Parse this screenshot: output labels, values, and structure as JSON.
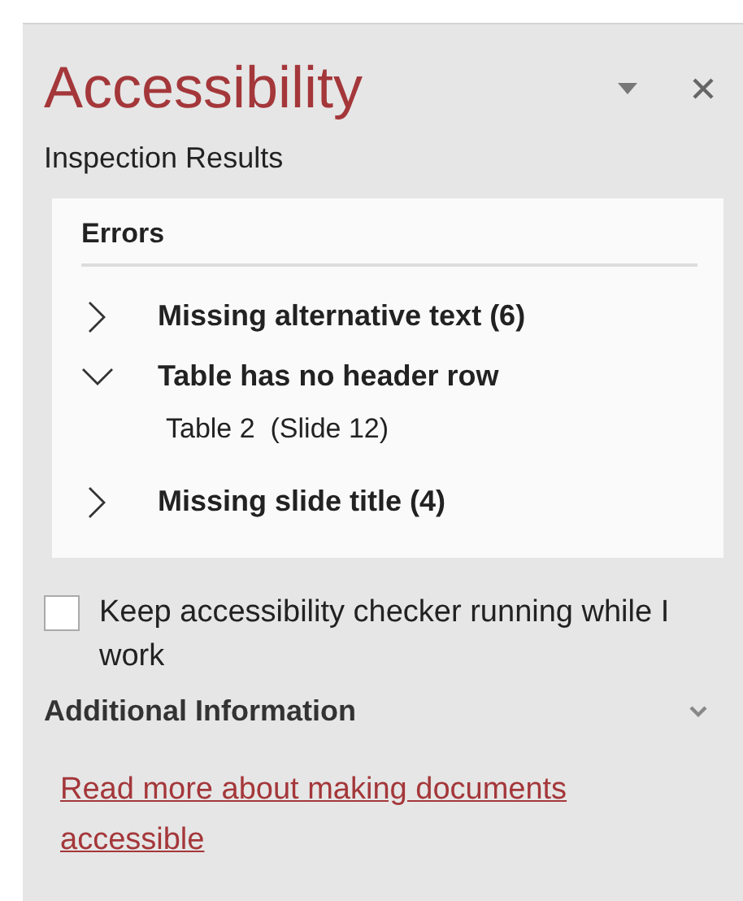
{
  "pane": {
    "title": "Accessibility",
    "subtitle": "Inspection Results"
  },
  "errors": {
    "heading": "Errors",
    "items": [
      {
        "label": "Missing alternative text (6)",
        "expanded": false
      },
      {
        "label": "Table has no header row",
        "expanded": true,
        "children": [
          {
            "label": "Table 2  (Slide 12)"
          }
        ]
      },
      {
        "label": "Missing slide title (4)",
        "expanded": false
      }
    ]
  },
  "keep_running": {
    "label": "Keep accessibility checker running while I work",
    "checked": false
  },
  "additional": {
    "heading": "Additional Information",
    "expanded": false,
    "link": "Read more about making documents accessible"
  }
}
